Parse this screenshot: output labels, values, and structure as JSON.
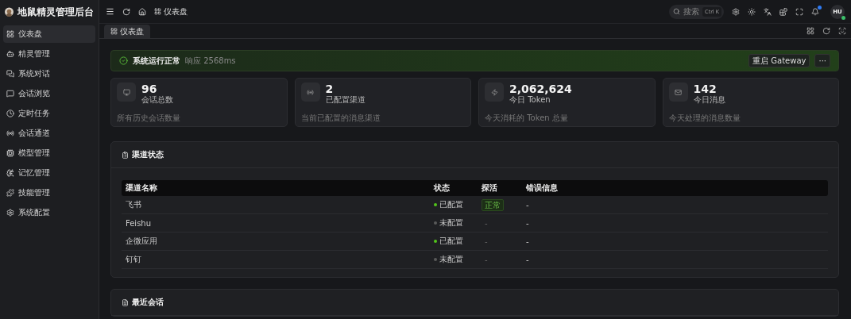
{
  "brand": {
    "title": "地鼠精灵管理后台"
  },
  "sidebar": {
    "items": [
      {
        "label": "仪表盘",
        "selected": true
      },
      {
        "label": "精灵管理",
        "selected": false
      },
      {
        "label": "系统对话",
        "selected": false
      },
      {
        "label": "会话浏览",
        "selected": false
      },
      {
        "label": "定时任务",
        "selected": false
      },
      {
        "label": "会话通道",
        "selected": false
      },
      {
        "label": "模型管理",
        "selected": false
      },
      {
        "label": "记忆管理",
        "selected": false
      },
      {
        "label": "技能管理",
        "selected": false
      },
      {
        "label": "系统配置",
        "selected": false
      }
    ]
  },
  "topbar": {
    "breadcrumb": "仪表盘",
    "search": {
      "placeholder": "搜索",
      "shortcut": "Ctrl K"
    },
    "notification_dot": true,
    "avatar": {
      "initials": "HU",
      "online": true
    }
  },
  "tabs": [
    {
      "label": "仪表盘",
      "selected": true
    }
  ],
  "status_banner": {
    "title": "系统运行正常",
    "latency": "响应 2568ms",
    "restart_button": "重启 Gateway",
    "more_button": "···"
  },
  "stats": [
    {
      "value": "96",
      "label": "会话总数",
      "description": "所有历史会话数量"
    },
    {
      "value": "2",
      "label": "已配置渠道",
      "description": "当前已配置的消息渠道"
    },
    {
      "value": "2,062,624",
      "label": "今日 Token",
      "description": "今天消耗的 Token 总量"
    },
    {
      "value": "142",
      "label": "今日消息",
      "description": "今天处理的消息数量"
    }
  ],
  "channel_panel": {
    "title": "渠道状态",
    "columns": [
      "渠道名称",
      "状态",
      "探活",
      "错误信息"
    ],
    "rows": [
      {
        "name": "飞书",
        "status": "已配置",
        "color": "#52c41a",
        "probe": "正常",
        "probe_tag": true,
        "error": "-"
      },
      {
        "name": "Feishu",
        "status": "未配置",
        "color": "#5a5a5a",
        "probe": "-",
        "probe_tag": false,
        "error": "-"
      },
      {
        "name": "企微应用",
        "status": "已配置",
        "color": "#52c41a",
        "probe": "-",
        "probe_tag": false,
        "error": "-"
      },
      {
        "name": "钉钉",
        "status": "未配置",
        "color": "#5a5a5a",
        "probe": "-",
        "probe_tag": false,
        "error": "-"
      }
    ]
  },
  "recent_panel": {
    "title": "最近会话"
  }
}
